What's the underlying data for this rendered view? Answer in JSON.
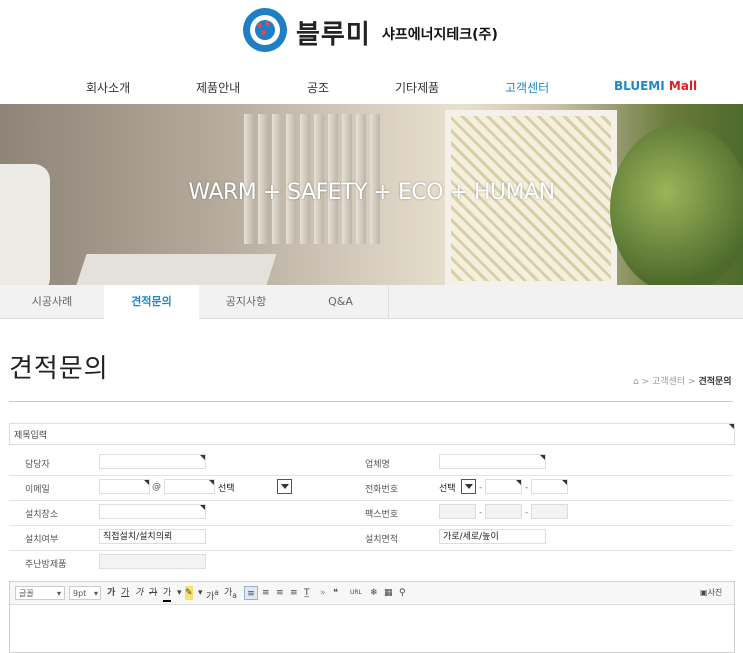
{
  "header": {
    "brand": "블루미",
    "company": "샤프에너지테크(주)",
    "nav": [
      {
        "label": "회사소개"
      },
      {
        "label": "제품안내"
      },
      {
        "label": "공조"
      },
      {
        "label": "기타제품"
      },
      {
        "label": "고객센터",
        "active": true
      },
      {
        "label_main": "BLUEMI",
        "label_accent": "Mall"
      }
    ]
  },
  "banner": {
    "slogan": "WARM + SAFETY + ECO + HUMAN"
  },
  "subtabs": [
    {
      "label": "시공사례"
    },
    {
      "label": "견적문의",
      "active": true
    },
    {
      "label": "공지사항"
    },
    {
      "label": "Q&A"
    }
  ],
  "page": {
    "title": "견적문의",
    "breadcrumb": {
      "parent": "고객센터",
      "current": "견적문의",
      "separator": ">"
    }
  },
  "form": {
    "subject_label": "제목입력",
    "manager_label": "담당자",
    "company_label": "업체명",
    "email_label": "이메일",
    "email_at": "@",
    "email_domain_select": "선택",
    "phone_label": "전화번호",
    "phone_prefix_select": "선택",
    "phone_dash": "-",
    "site_label": "설치장소",
    "fax_label": "팩스번호",
    "install_type_label": "설치여부",
    "install_type_value": "직접설치/설치의뢰",
    "area_label": "설치면적",
    "area_value": "가로/세로/높이",
    "product_label": "주난방제품"
  },
  "editor": {
    "font_select": "글꼴",
    "size_select": "9pt",
    "buttons": [
      "가",
      "가",
      "가",
      "가",
      "가",
      "가",
      "가",
      "가"
    ],
    "superscript": "가",
    "subscript": "가",
    "quote_icon": "❝",
    "url_label": "URL",
    "photo_label": "사진"
  },
  "colors": {
    "accent": "#1f88c8",
    "mall_red": "#e01e26",
    "logo_blue": "#1e7fc4"
  }
}
